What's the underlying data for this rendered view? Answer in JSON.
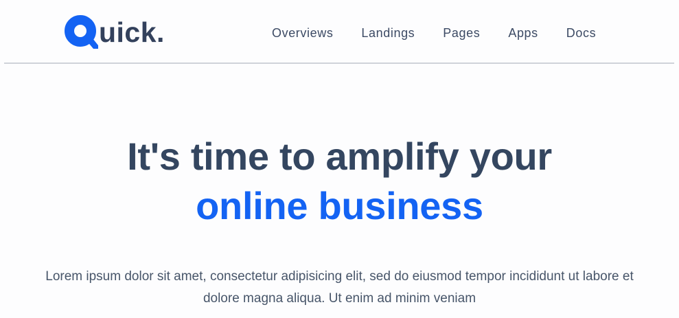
{
  "brand": {
    "logo_text": "uick",
    "logo_dot": ".",
    "brand_color": "#1463f3",
    "text_color": "#33415c"
  },
  "nav": {
    "items": [
      {
        "label": "Overviews"
      },
      {
        "label": "Landings"
      },
      {
        "label": "Pages"
      },
      {
        "label": "Apps"
      },
      {
        "label": "Docs"
      }
    ]
  },
  "hero": {
    "title_line1": "It's time to amplify your",
    "title_line2": "online business",
    "title_color": "#344660",
    "accent_color": "#1463f3",
    "lead": "Lorem ipsum dolor sit amet, consectetur adipisicing elit, sed do eiusmod tempor incididunt ut labore et dolore magna aliqua. Ut enim ad minim veniam"
  }
}
